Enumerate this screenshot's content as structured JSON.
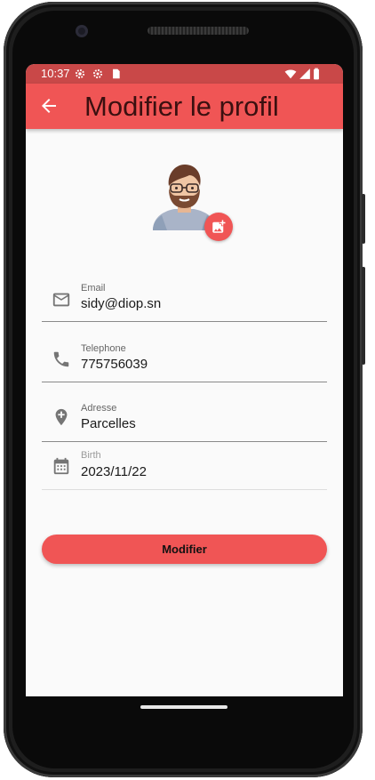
{
  "status_bar": {
    "time": "10:37"
  },
  "app_bar": {
    "title": "Modifier le profil"
  },
  "form": {
    "fields": [
      {
        "label": "Email",
        "value": "sidy@diop.sn",
        "icon": "mail-icon"
      },
      {
        "label": "Telephone",
        "value": "775756039",
        "icon": "phone-icon"
      },
      {
        "label": "Adresse",
        "value": "Parcelles",
        "icon": "location-add-icon"
      },
      {
        "label": "Birth",
        "value": "2023/11/22",
        "icon": "calendar-icon"
      }
    ],
    "submit_label": "Modifier"
  },
  "colors": {
    "accent": "#f05555",
    "status_bar": "#c94848",
    "background": "#fafafa"
  }
}
